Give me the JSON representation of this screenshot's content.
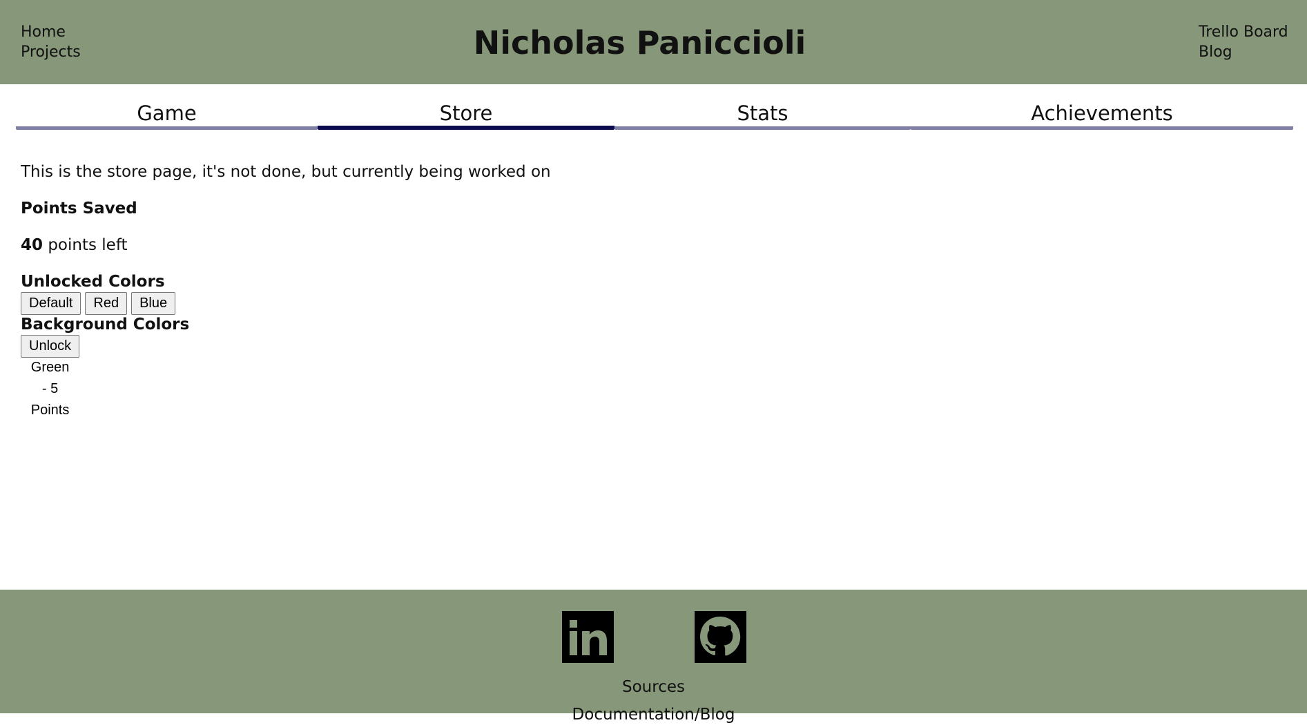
{
  "header": {
    "title": "Nicholas Paniccioli",
    "left_links": [
      "Home",
      "Projects"
    ],
    "right_links": [
      "Trello Board",
      "Blog"
    ],
    "background_color": "#879779"
  },
  "tabs": [
    {
      "label": "Game",
      "active": false
    },
    {
      "label": "Store",
      "active": true
    },
    {
      "label": "Stats",
      "active": false
    },
    {
      "label": "Achievements",
      "active": false
    }
  ],
  "tab_colors": {
    "inactive": "#7f7ea4",
    "active": "#0b0a4c"
  },
  "store": {
    "intro": "This is the store page, it's not done, but currently being worked on",
    "points_saved_heading": "Points Saved",
    "points_value": "40",
    "points_suffix": " points left",
    "unlocked_heading": "Unlocked Colors",
    "unlocked_buttons": [
      "Default",
      "Red",
      "Blue"
    ],
    "background_heading": "Background Colors",
    "background_buttons": [
      "Unlock Green - 5 Points"
    ]
  },
  "footer": {
    "icons": [
      "linkedin-icon",
      "github-icon"
    ],
    "sources_label": "Sources",
    "docs_label": "Documentation/Blog"
  }
}
